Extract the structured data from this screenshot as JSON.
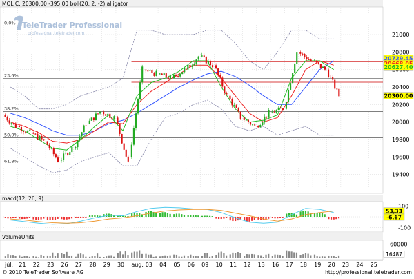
{
  "header": {
    "main": "MOL C: 20300,00 -395,00 boll(20, 2, -2) alligator",
    "macd": "macd(12, 26, 9)",
    "volume": "VolumeUnits"
  },
  "watermark": "TeleTrader Professional",
  "watermark_url": "professional.teletrader.com",
  "footer": {
    "copyright": "© 2010 TeleTrader Software AG",
    "url": "http://professional.teletrader.com"
  },
  "colors": {
    "up_candle": "#22aa22",
    "down_candle": "#dd1111",
    "bollinger": "#8888aa",
    "alligator_jaw": "#3355ff",
    "alligator_teeth": "#ee2222",
    "alligator_lips": "#22bb22",
    "resistance": "#cc0000",
    "fib": "#555555",
    "macd_line": "#55ccee",
    "signal_line": "#ee9933",
    "hist_up": "#33bb33",
    "hist_down": "#ee3333",
    "price_label_bg": "#ffff00"
  },
  "chart_data": [
    {
      "type": "candlestick",
      "title": "MOL C: 20300,00 -395,00 boll(20, 2, -2) alligator",
      "x_tick_labels": [
        "júl.",
        "21",
        "22",
        "23",
        "26",
        "27",
        "28",
        "29",
        "30",
        "aug.",
        "03",
        "04",
        "05",
        "06",
        "09",
        "10",
        "11",
        "12",
        "13",
        "16",
        "17",
        "18",
        "19",
        "20",
        "23",
        "24",
        "25"
      ],
      "ylim": [
        19200,
        21300
      ],
      "y_ticks": [
        19400,
        19600,
        19800,
        20000,
        20200,
        20400,
        20600,
        20800,
        21000
      ],
      "fib_levels": [
        {
          "label": "0,0%",
          "value": 21100
        },
        {
          "label": "23,6%",
          "value": 20500
        },
        {
          "label": "38,2%",
          "value": 20120
        },
        {
          "label": "50,0%",
          "value": 19820
        },
        {
          "label": "61,8%",
          "value": 19520
        }
      ],
      "resistance_levels": [
        20690,
        20455
      ],
      "price_labels": [
        {
          "text": "20729,45",
          "value": 20729.45,
          "color": "#3355ff"
        },
        {
          "text": "20668,05",
          "value": 20668.05,
          "color": "#ee2222"
        },
        {
          "text": "20627,40",
          "value": 20627.4,
          "color": "#22bb22"
        },
        {
          "text": "20300,00",
          "value": 20300,
          "color": "#000000"
        }
      ],
      "days": [
        {
          "x": "júl.",
          "open": 20080,
          "close": 19950
        },
        {
          "x": "21",
          "open": 19950,
          "close": 19880
        },
        {
          "x": "22",
          "open": 19880,
          "close": 19780
        },
        {
          "x": "23",
          "open": 19780,
          "close": 19560
        },
        {
          "x": "26",
          "open": 19560,
          "close": 19700
        },
        {
          "x": "27",
          "open": 19700,
          "close": 19980
        },
        {
          "x": "28",
          "open": 19980,
          "close": 20120
        },
        {
          "x": "29",
          "open": 20120,
          "close": 20050
        },
        {
          "x": "30",
          "open": 20050,
          "close": 19520
        },
        {
          "x": "aug.",
          "open": 19600,
          "close": 20600
        },
        {
          "x": "03",
          "open": 20600,
          "close": 20550
        },
        {
          "x": "04",
          "open": 20550,
          "close": 20500
        },
        {
          "x": "05",
          "open": 20500,
          "close": 20600
        },
        {
          "x": "06",
          "open": 20600,
          "close": 20750
        },
        {
          "x": "09",
          "open": 20750,
          "close": 20650
        },
        {
          "x": "10",
          "open": 20650,
          "close": 20300
        },
        {
          "x": "11",
          "open": 20300,
          "close": 20050
        },
        {
          "x": "12",
          "open": 20050,
          "close": 19950
        },
        {
          "x": "13",
          "open": 19950,
          "close": 20100
        },
        {
          "x": "16",
          "open": 20100,
          "close": 20150
        },
        {
          "x": "17",
          "open": 20150,
          "close": 20800
        },
        {
          "x": "18",
          "open": 20800,
          "close": 20700
        },
        {
          "x": "19",
          "open": 20700,
          "close": 20600
        },
        {
          "x": "20",
          "open": 20600,
          "close": 20300
        }
      ],
      "bollinger_upper": [
        20400,
        20300,
        20150,
        20150,
        20200,
        20300,
        20350,
        20400,
        20500,
        21050,
        21050,
        21000,
        21000,
        21000,
        21050,
        21050,
        20900,
        20700,
        20600,
        20800,
        21050,
        21050,
        20950,
        20950
      ],
      "bollinger_lower": [
        19700,
        19600,
        19500,
        19420,
        19450,
        19550,
        19600,
        19650,
        19500,
        19500,
        19800,
        20050,
        20100,
        20200,
        20250,
        20150,
        19950,
        19900,
        19950,
        19850,
        19900,
        19950,
        19850,
        19850
      ],
      "alligator_jaw": [
        20100,
        20050,
        19980,
        19900,
        19850,
        19850,
        19900,
        19980,
        20020,
        20100,
        20200,
        20300,
        20400,
        20480,
        20550,
        20580,
        20520,
        20420,
        20300,
        20200,
        20200,
        20400,
        20600,
        20700
      ],
      "alligator_teeth": [
        20000,
        19950,
        19880,
        19780,
        19760,
        19800,
        19900,
        20000,
        19980,
        20200,
        20350,
        20450,
        20550,
        20650,
        20650,
        20500,
        20300,
        20100,
        20000,
        20050,
        20300,
        20600,
        20700,
        20650
      ],
      "alligator_lips": [
        19950,
        19900,
        19800,
        19700,
        19680,
        19800,
        19950,
        20080,
        19900,
        20300,
        20450,
        20500,
        20580,
        20700,
        20700,
        20400,
        20150,
        20000,
        20020,
        20080,
        20500,
        20700,
        20700,
        20600
      ]
    },
    {
      "type": "bar",
      "title": "macd(12, 26, 9)",
      "ylim": [
        -130,
        130
      ],
      "y_ticks": [
        100,
        0,
        -100
      ],
      "value_labels": [
        {
          "text": "53,33",
          "value": 53.33
        },
        {
          "text": "-6,67",
          "value": -6.67
        }
      ],
      "histogram": [
        -15,
        -20,
        -28,
        -32,
        -25,
        -10,
        15,
        30,
        10,
        40,
        55,
        45,
        30,
        20,
        10,
        -20,
        -40,
        -45,
        -30,
        -15,
        35,
        60,
        40,
        -25
      ],
      "macd": [
        -30,
        -45,
        -60,
        -70,
        -65,
        -40,
        -10,
        15,
        10,
        50,
        80,
        90,
        85,
        75,
        70,
        40,
        -10,
        -50,
        -60,
        -50,
        20,
        80,
        70,
        40
      ],
      "signal": [
        -20,
        -30,
        -45,
        -55,
        -60,
        -55,
        -40,
        -20,
        -10,
        10,
        35,
        55,
        65,
        70,
        70,
        60,
        35,
        10,
        -20,
        -40,
        -20,
        20,
        40,
        55
      ]
    },
    {
      "type": "bar",
      "title": "VolumeUnits",
      "ylim": [
        0,
        70000
      ],
      "y_ticks": [
        60000
      ],
      "last_value_label": "16487",
      "last_value": 16487,
      "values": [
        20000,
        18000,
        15000,
        25000,
        30000,
        22000,
        20000,
        18000,
        45000,
        35000,
        20000,
        15000,
        16000,
        18000,
        22000,
        28000,
        30000,
        20000,
        18000,
        25000,
        60000,
        35000,
        20000,
        16487
      ]
    }
  ]
}
